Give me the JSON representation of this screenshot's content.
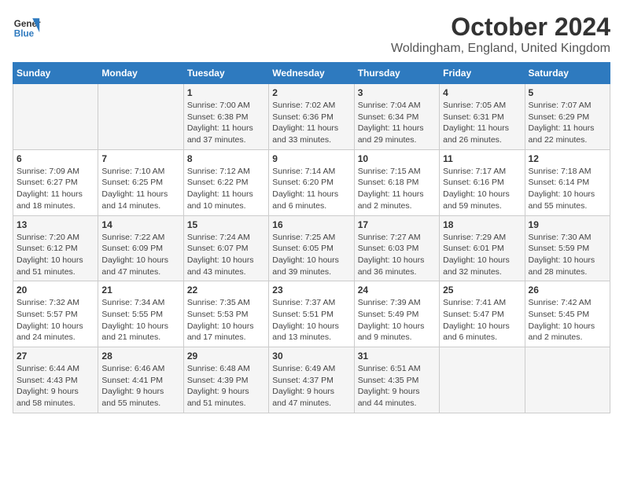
{
  "header": {
    "logo_text_general": "General",
    "logo_text_blue": "Blue",
    "month": "October 2024",
    "location": "Woldingham, England, United Kingdom"
  },
  "weekdays": [
    "Sunday",
    "Monday",
    "Tuesday",
    "Wednesday",
    "Thursday",
    "Friday",
    "Saturday"
  ],
  "weeks": [
    [
      {
        "day": "",
        "detail": ""
      },
      {
        "day": "",
        "detail": ""
      },
      {
        "day": "1",
        "detail": "Sunrise: 7:00 AM\nSunset: 6:38 PM\nDaylight: 11 hours\nand 37 minutes."
      },
      {
        "day": "2",
        "detail": "Sunrise: 7:02 AM\nSunset: 6:36 PM\nDaylight: 11 hours\nand 33 minutes."
      },
      {
        "day": "3",
        "detail": "Sunrise: 7:04 AM\nSunset: 6:34 PM\nDaylight: 11 hours\nand 29 minutes."
      },
      {
        "day": "4",
        "detail": "Sunrise: 7:05 AM\nSunset: 6:31 PM\nDaylight: 11 hours\nand 26 minutes."
      },
      {
        "day": "5",
        "detail": "Sunrise: 7:07 AM\nSunset: 6:29 PM\nDaylight: 11 hours\nand 22 minutes."
      }
    ],
    [
      {
        "day": "6",
        "detail": "Sunrise: 7:09 AM\nSunset: 6:27 PM\nDaylight: 11 hours\nand 18 minutes."
      },
      {
        "day": "7",
        "detail": "Sunrise: 7:10 AM\nSunset: 6:25 PM\nDaylight: 11 hours\nand 14 minutes."
      },
      {
        "day": "8",
        "detail": "Sunrise: 7:12 AM\nSunset: 6:22 PM\nDaylight: 11 hours\nand 10 minutes."
      },
      {
        "day": "9",
        "detail": "Sunrise: 7:14 AM\nSunset: 6:20 PM\nDaylight: 11 hours\nand 6 minutes."
      },
      {
        "day": "10",
        "detail": "Sunrise: 7:15 AM\nSunset: 6:18 PM\nDaylight: 11 hours\nand 2 minutes."
      },
      {
        "day": "11",
        "detail": "Sunrise: 7:17 AM\nSunset: 6:16 PM\nDaylight: 10 hours\nand 59 minutes."
      },
      {
        "day": "12",
        "detail": "Sunrise: 7:18 AM\nSunset: 6:14 PM\nDaylight: 10 hours\nand 55 minutes."
      }
    ],
    [
      {
        "day": "13",
        "detail": "Sunrise: 7:20 AM\nSunset: 6:12 PM\nDaylight: 10 hours\nand 51 minutes."
      },
      {
        "day": "14",
        "detail": "Sunrise: 7:22 AM\nSunset: 6:09 PM\nDaylight: 10 hours\nand 47 minutes."
      },
      {
        "day": "15",
        "detail": "Sunrise: 7:24 AM\nSunset: 6:07 PM\nDaylight: 10 hours\nand 43 minutes."
      },
      {
        "day": "16",
        "detail": "Sunrise: 7:25 AM\nSunset: 6:05 PM\nDaylight: 10 hours\nand 39 minutes."
      },
      {
        "day": "17",
        "detail": "Sunrise: 7:27 AM\nSunset: 6:03 PM\nDaylight: 10 hours\nand 36 minutes."
      },
      {
        "day": "18",
        "detail": "Sunrise: 7:29 AM\nSunset: 6:01 PM\nDaylight: 10 hours\nand 32 minutes."
      },
      {
        "day": "19",
        "detail": "Sunrise: 7:30 AM\nSunset: 5:59 PM\nDaylight: 10 hours\nand 28 minutes."
      }
    ],
    [
      {
        "day": "20",
        "detail": "Sunrise: 7:32 AM\nSunset: 5:57 PM\nDaylight: 10 hours\nand 24 minutes."
      },
      {
        "day": "21",
        "detail": "Sunrise: 7:34 AM\nSunset: 5:55 PM\nDaylight: 10 hours\nand 21 minutes."
      },
      {
        "day": "22",
        "detail": "Sunrise: 7:35 AM\nSunset: 5:53 PM\nDaylight: 10 hours\nand 17 minutes."
      },
      {
        "day": "23",
        "detail": "Sunrise: 7:37 AM\nSunset: 5:51 PM\nDaylight: 10 hours\nand 13 minutes."
      },
      {
        "day": "24",
        "detail": "Sunrise: 7:39 AM\nSunset: 5:49 PM\nDaylight: 10 hours\nand 9 minutes."
      },
      {
        "day": "25",
        "detail": "Sunrise: 7:41 AM\nSunset: 5:47 PM\nDaylight: 10 hours\nand 6 minutes."
      },
      {
        "day": "26",
        "detail": "Sunrise: 7:42 AM\nSunset: 5:45 PM\nDaylight: 10 hours\nand 2 minutes."
      }
    ],
    [
      {
        "day": "27",
        "detail": "Sunrise: 6:44 AM\nSunset: 4:43 PM\nDaylight: 9 hours\nand 58 minutes."
      },
      {
        "day": "28",
        "detail": "Sunrise: 6:46 AM\nSunset: 4:41 PM\nDaylight: 9 hours\nand 55 minutes."
      },
      {
        "day": "29",
        "detail": "Sunrise: 6:48 AM\nSunset: 4:39 PM\nDaylight: 9 hours\nand 51 minutes."
      },
      {
        "day": "30",
        "detail": "Sunrise: 6:49 AM\nSunset: 4:37 PM\nDaylight: 9 hours\nand 47 minutes."
      },
      {
        "day": "31",
        "detail": "Sunrise: 6:51 AM\nSunset: 4:35 PM\nDaylight: 9 hours\nand 44 minutes."
      },
      {
        "day": "",
        "detail": ""
      },
      {
        "day": "",
        "detail": ""
      }
    ]
  ]
}
